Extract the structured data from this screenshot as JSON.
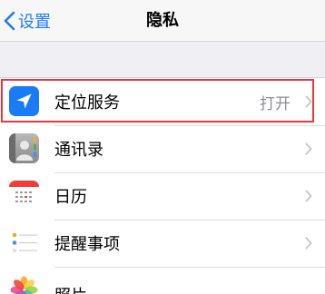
{
  "nav": {
    "back_label": "设置",
    "title": "隐私"
  },
  "rows": [
    {
      "label": "定位服务",
      "value": "打开",
      "icon": "location-arrow-icon"
    },
    {
      "label": "通讯录",
      "value": "",
      "icon": "contacts-icon"
    },
    {
      "label": "日历",
      "value": "",
      "icon": "calendar-icon"
    },
    {
      "label": "提醒事项",
      "value": "",
      "icon": "reminders-icon"
    },
    {
      "label": "照片",
      "value": "",
      "icon": "photos-icon"
    }
  ],
  "colors": {
    "accent": "#1e7cf2",
    "highlight_border": "#e8383c",
    "background": "#efeff4"
  }
}
